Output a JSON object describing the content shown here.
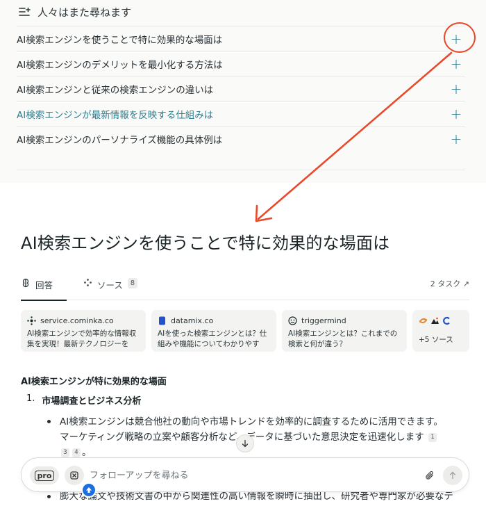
{
  "related": {
    "title": "人々はまた尋ねます",
    "questions": [
      {
        "text": "AI検索エンジンを使うことで特に効果的な場面は"
      },
      {
        "text": "AI検索エンジンのデメリットを最小化する方法は"
      },
      {
        "text": "AI検索エンジンと従来の検索エンジンの違いは"
      },
      {
        "text": "AI検索エンジンが最新情報を反映する仕組みは"
      },
      {
        "text": "AI検索エンジンのパーソナライズ機能の具体例は"
      }
    ],
    "plus_symbol": "+"
  },
  "annotation": {
    "color": "#e8492b"
  },
  "answer": {
    "title": "AI検索エンジンを使うことで特に効果的な場面は",
    "tabs": {
      "answer_label": "回答",
      "sources_label": "ソース",
      "sources_count": "8",
      "tasks_label": "2 タスク ↗"
    },
    "source_cards": [
      {
        "site": "service.cominka.co",
        "snippet": "AI検索エンジンで効率的な情報収集を実現！最新テクノロジーを徹…"
      },
      {
        "site": "datamix.co",
        "snippet": "AIを使った検索エンジンとは？仕組みや機能についてわかりやすく…"
      },
      {
        "site": "triggermind",
        "snippet": "AI検索エンジンとは？これまでの検索と何が違う？"
      }
    ],
    "more_sources": "+5 ソース",
    "heading": "AI検索エンジンが特に効果的な場面",
    "list_num": "1.",
    "list_title": "市場調査とビジネス分析",
    "bullet1": "AI検索エンジンは競合他社の動向や市場トレンドを効率的に調査するために活用できます。マーケティング戦略の立案や顧客分析など、データに基づいた意思決定を迅速化します",
    "bullet1_end": "。",
    "citations": [
      "1",
      "3",
      "4"
    ],
    "bullet2": "膨大な論文や技術文書の中から関連性の高い情報を瞬時に抽出し、研究者や専門家が必要なデ"
  },
  "followup": {
    "pro_label": "pro",
    "placeholder": "フォローアップを尋ねる"
  },
  "accent_color": "#2e7f91"
}
